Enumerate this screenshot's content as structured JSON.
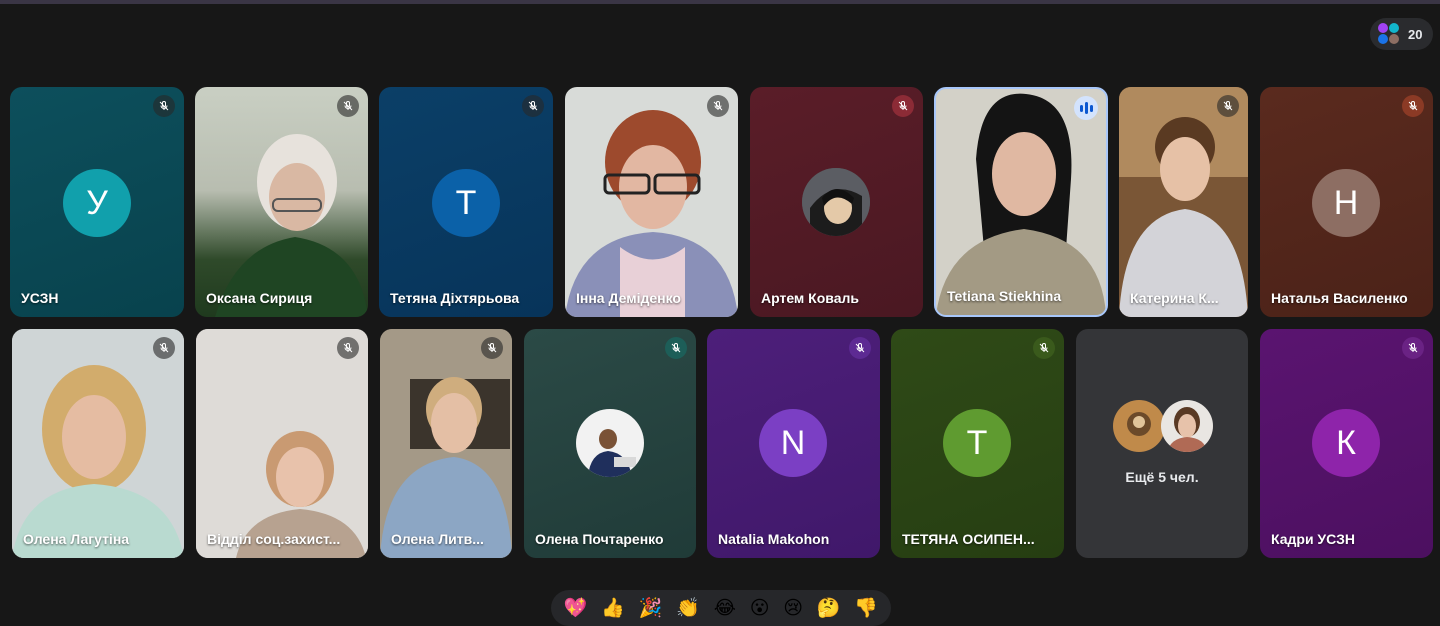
{
  "participants_count": "20",
  "colors": {
    "speaking_border": "#a8c7fa",
    "background": "#171717"
  },
  "tiles": [
    {
      "name": "УСЗН",
      "avatar": "У",
      "muted": true
    },
    {
      "name": "Оксана Сириця",
      "muted": true
    },
    {
      "name": "Тетяна Діхтярьова",
      "avatar": "Т",
      "muted": true
    },
    {
      "name": "Інна Деміденко",
      "muted": true
    },
    {
      "name": "Артем Коваль",
      "muted": true
    },
    {
      "name": "Tetiana Stiekhina",
      "muted": false,
      "speaking": true
    },
    {
      "name": "Катерина К...",
      "muted": true
    },
    {
      "name": "Наталья Василенко",
      "avatar": "Н",
      "muted": true
    },
    {
      "name": "Олена Лагутіна",
      "muted": true
    },
    {
      "name": "Відділ соц.захист...",
      "muted": true
    },
    {
      "name": "Олена Литв...",
      "muted": true
    },
    {
      "name": "Олена Почтаренко",
      "muted": true
    },
    {
      "name": "Natalia Makohon",
      "avatar": "N",
      "muted": true
    },
    {
      "name": "ТЕТЯНА ОСИПЕН...",
      "avatar": "T",
      "muted": true
    },
    {
      "name": "Ещё 5 чел."
    },
    {
      "name": "Кадри УСЗН",
      "avatar": "К",
      "muted": true
    }
  ],
  "reactions": [
    "💖",
    "👍",
    "🎉",
    "👏",
    "😂",
    "😮",
    "😢",
    "🤔",
    "👎"
  ]
}
